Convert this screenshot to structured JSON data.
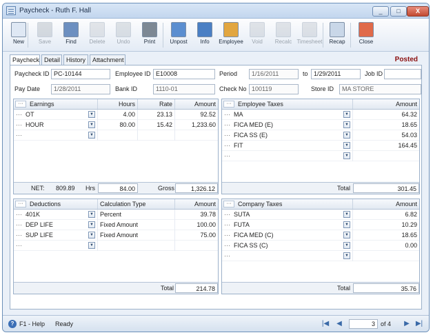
{
  "window": {
    "title": "Paycheck - Ruth F. Hall",
    "minimize": "_",
    "maximize": "□",
    "close": "X"
  },
  "toolbar": [
    {
      "label": "New",
      "icon": "new-icon",
      "enabled": true
    },
    {
      "label": "Save",
      "icon": "save-icon",
      "enabled": false
    },
    {
      "label": "Find",
      "icon": "find-icon",
      "enabled": true
    },
    {
      "label": "Delete",
      "icon": "delete-icon",
      "enabled": false
    },
    {
      "label": "Undo",
      "icon": "undo-icon",
      "enabled": false
    },
    {
      "label": "Print",
      "icon": "print-icon",
      "enabled": true
    },
    {
      "label": "Unpost",
      "icon": "unpost-icon",
      "enabled": true
    },
    {
      "label": "Info",
      "icon": "info-icon",
      "enabled": true
    },
    {
      "label": "Employee",
      "icon": "employee-icon",
      "enabled": true
    },
    {
      "label": "Void",
      "icon": "void-icon",
      "enabled": false
    },
    {
      "label": "Recalc",
      "icon": "recalc-icon",
      "enabled": false
    },
    {
      "label": "Timesheet",
      "icon": "timesheet-icon",
      "enabled": false
    },
    {
      "label": "Recap",
      "icon": "recap-icon",
      "enabled": true
    },
    {
      "label": "Close",
      "icon": "close-doc-icon",
      "enabled": true
    }
  ],
  "tabs": [
    "Paycheck",
    "Detail",
    "History",
    "Attachment"
  ],
  "status_posted": "Posted",
  "form": {
    "paycheck_id_label": "Paycheck ID",
    "paycheck_id": "PC-10144",
    "employee_id_label": "Employee ID",
    "employee_id": "E10008",
    "period_label": "Period",
    "period_from": "1/16/2011",
    "to_label": "to",
    "period_to": "1/29/2011",
    "job_id_label": "Job ID",
    "job_id": "",
    "pay_date_label": "Pay Date",
    "pay_date": "1/28/2011",
    "bank_id_label": "Bank ID",
    "bank_id": "1110-01",
    "check_no_label": "Check No",
    "check_no": "100119",
    "store_id_label": "Store ID",
    "store_id": "MA STORE"
  },
  "earnings": {
    "headers": [
      "Earnings",
      "Hours",
      "Rate",
      "Amount"
    ],
    "rows": [
      {
        "name": "OT",
        "hours": "4.00",
        "rate": "23.13",
        "amount": "92.52"
      },
      {
        "name": "HOUR",
        "hours": "80.00",
        "rate": "15.42",
        "amount": "1,233.60"
      },
      {
        "name": "",
        "hours": "",
        "rate": "",
        "amount": ""
      }
    ],
    "net_label": "NET:",
    "net": "809.89",
    "hrs_label": "Hrs",
    "hrs": "84.00",
    "gross_label": "Gross",
    "gross": "1,326.12"
  },
  "employee_taxes": {
    "headers": [
      "Employee Taxes",
      "Amount"
    ],
    "rows": [
      {
        "name": "MA",
        "amount": "64.32"
      },
      {
        "name": "FICA MED (E)",
        "amount": "18.65"
      },
      {
        "name": "FICA SS (E)",
        "amount": "54.03"
      },
      {
        "name": "FIT",
        "amount": "164.45"
      },
      {
        "name": "",
        "amount": ""
      }
    ],
    "total_label": "Total",
    "total": "301.45"
  },
  "deductions": {
    "headers": [
      "Deductions",
      "Calculation Type",
      "Amount"
    ],
    "rows": [
      {
        "name": "401K",
        "calc": "Percent",
        "amount": "39.78"
      },
      {
        "name": "DEP LIFE",
        "calc": "Fixed Amount",
        "amount": "100.00"
      },
      {
        "name": "SUP LIFE",
        "calc": "Fixed Amount",
        "amount": "75.00"
      },
      {
        "name": "",
        "calc": "",
        "amount": ""
      }
    ],
    "total_label": "Total",
    "total": "214.78"
  },
  "company_taxes": {
    "headers": [
      "Company Taxes",
      "Amount"
    ],
    "rows": [
      {
        "name": "SUTA",
        "amount": "6.82"
      },
      {
        "name": "FUTA",
        "amount": "10.29"
      },
      {
        "name": "FICA MED (C)",
        "amount": "18.65"
      },
      {
        "name": "FICA SS (C)",
        "amount": "0.00"
      },
      {
        "name": "",
        "amount": ""
      }
    ],
    "total_label": "Total",
    "total": "35.76"
  },
  "statusbar": {
    "help": "F1 - Help",
    "status": "Ready",
    "page": "3",
    "of_label": "of 4"
  },
  "colors": {
    "posted": "#8b0f0f",
    "window_border": "#6b8fb8"
  }
}
